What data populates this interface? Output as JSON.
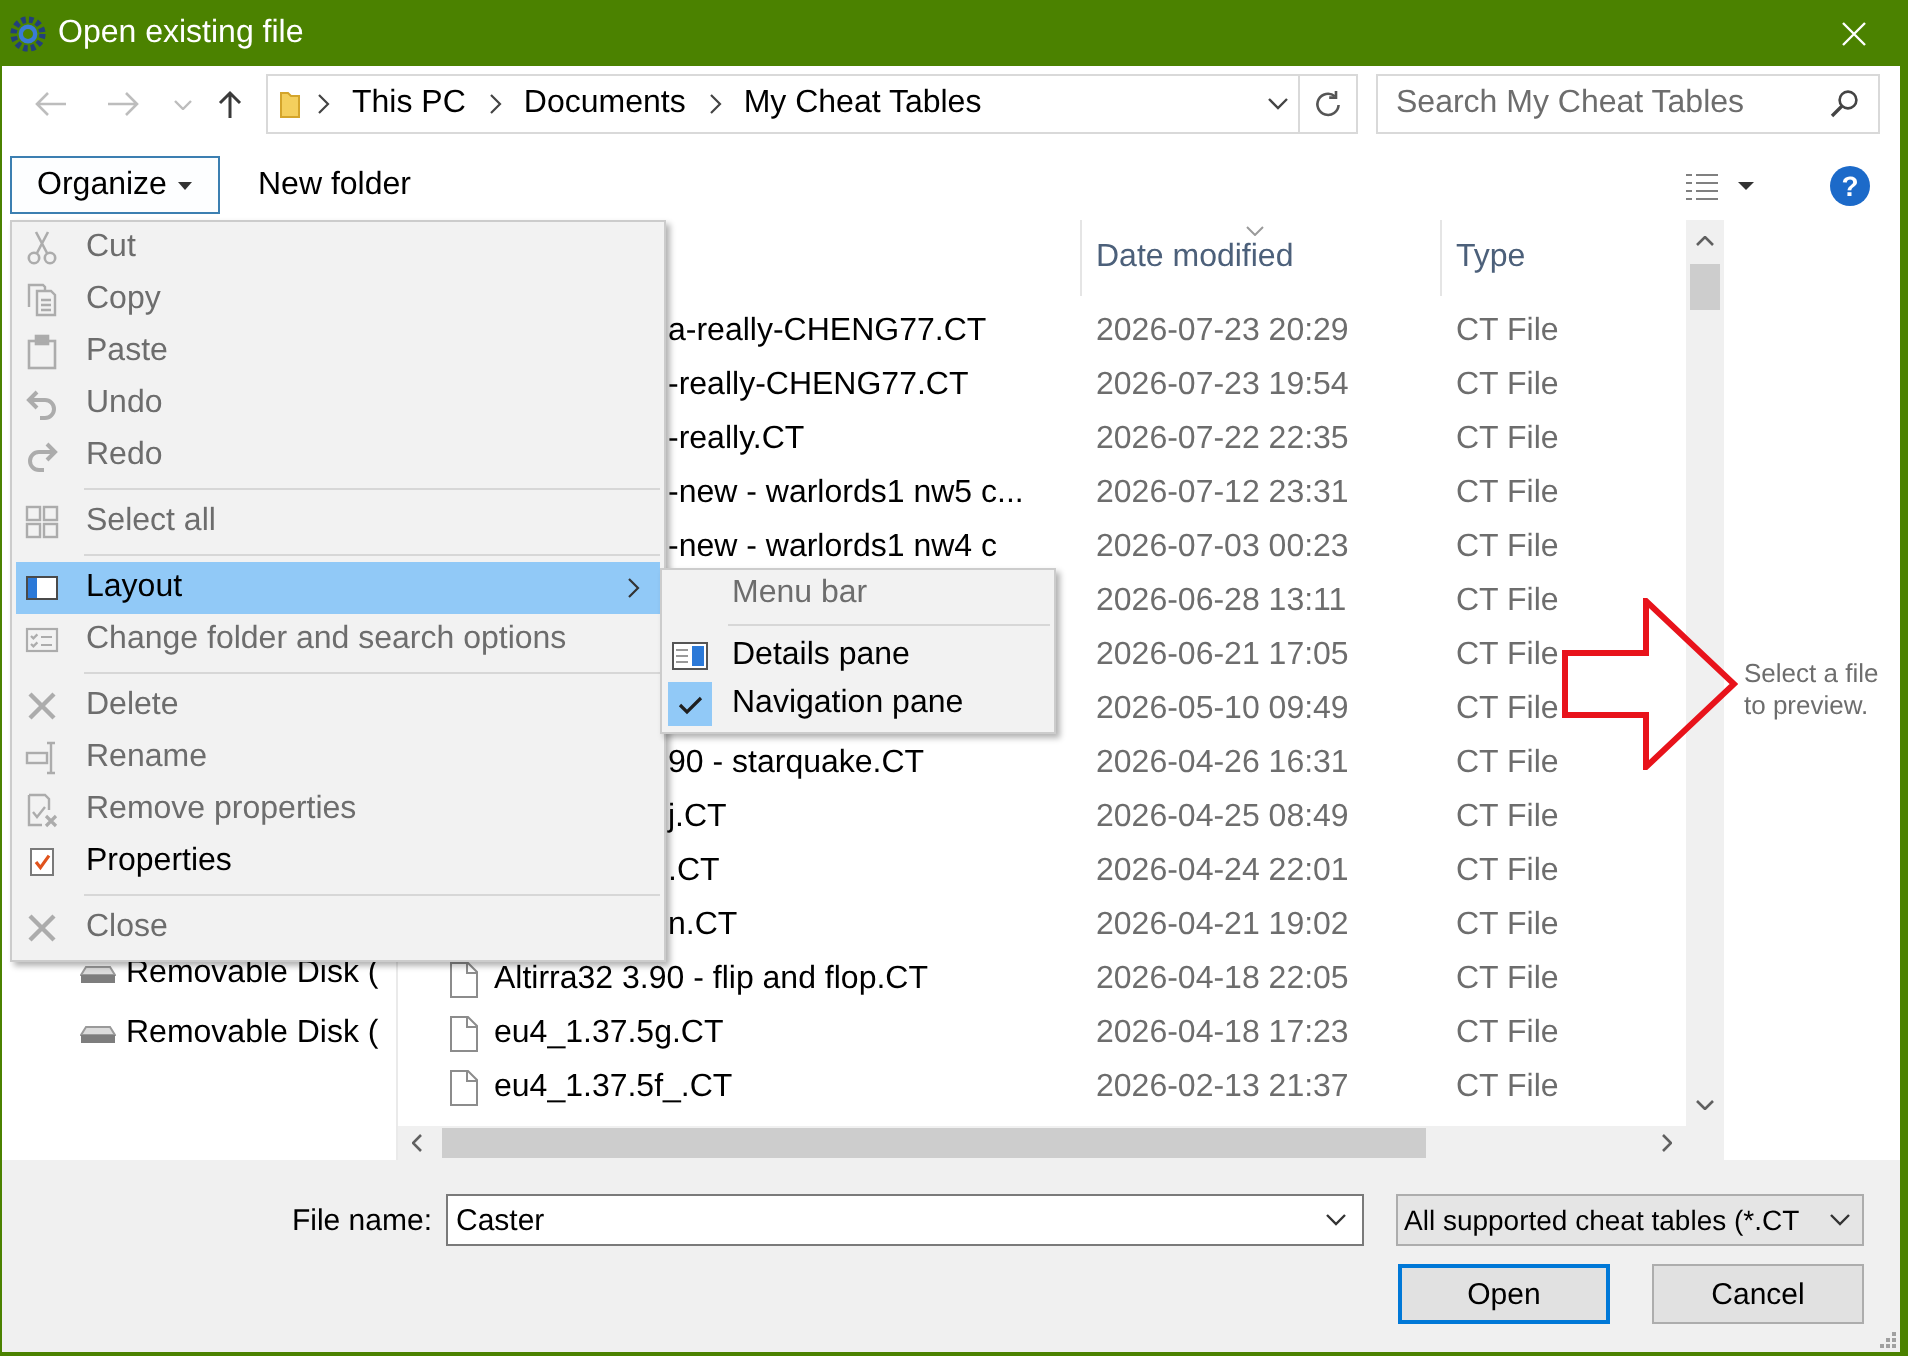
{
  "window": {
    "title": "Open existing file"
  },
  "history_buttons": [
    {
      "kind": "back",
      "disabled": true
    },
    {
      "kind": "forward",
      "disabled": true
    },
    {
      "kind": "recent",
      "disabled": true
    },
    {
      "kind": "up",
      "disabled": false
    }
  ],
  "address_bar": {
    "path": [
      "This PC",
      "Documents",
      "My Cheat Tables"
    ]
  },
  "search": {
    "placeholder": "Search My Cheat Tables"
  },
  "toolbar": {
    "organize": {
      "label": "Organize",
      "expanded": true
    },
    "new_folder": "New folder",
    "help": "?"
  },
  "organize_menu": {
    "groups": [
      [
        {
          "label": "Cut",
          "disabled": true,
          "highlighted": false,
          "submenu": false
        },
        {
          "label": "Copy",
          "disabled": true,
          "highlighted": false,
          "submenu": false
        },
        {
          "label": "Paste",
          "disabled": true,
          "highlighted": false,
          "submenu": false
        },
        {
          "label": "Undo",
          "disabled": true,
          "highlighted": false,
          "submenu": false
        },
        {
          "label": "Redo",
          "disabled": true,
          "highlighted": false,
          "submenu": false
        }
      ],
      [
        {
          "label": "Select all",
          "disabled": true,
          "highlighted": false,
          "submenu": false
        }
      ],
      [
        {
          "label": "Layout",
          "disabled": false,
          "highlighted": true,
          "submenu": true
        },
        {
          "label": "Change folder and search options",
          "disabled": true,
          "highlighted": false,
          "submenu": false
        }
      ],
      [
        {
          "label": "Delete",
          "disabled": true,
          "highlighted": false,
          "submenu": false
        },
        {
          "label": "Rename",
          "disabled": true,
          "highlighted": false,
          "submenu": false
        },
        {
          "label": "Remove properties",
          "disabled": true,
          "highlighted": false,
          "submenu": false
        },
        {
          "label": "Properties",
          "disabled": false,
          "highlighted": false,
          "submenu": false
        }
      ],
      [
        {
          "label": "Close",
          "disabled": true,
          "highlighted": false,
          "submenu": false
        }
      ]
    ]
  },
  "layout_submenu": {
    "groups": [
      [
        {
          "label": "Menu bar",
          "disabled": true,
          "checked": false
        }
      ],
      [
        {
          "label": "Details pane",
          "disabled": false,
          "checked": false
        },
        {
          "label": "Navigation pane",
          "disabled": false,
          "checked": true
        }
      ]
    ]
  },
  "navigation_pane": {
    "items": [
      {
        "label": "Removable Disk ("
      },
      {
        "label": "Removable Disk ("
      }
    ]
  },
  "file_list": {
    "columns": [
      {
        "label": "Date modified",
        "sorted": true
      },
      {
        "label": "Type",
        "sorted": false
      }
    ],
    "rows": [
      {
        "kind": "partial",
        "name": "a-really-CHENG77.CT",
        "date": "2026-07-23 20:29",
        "type": "CT File"
      },
      {
        "kind": "partial",
        "name": "-really-CHENG77.CT",
        "date": "2026-07-23 19:54",
        "type": "CT File"
      },
      {
        "kind": "partial",
        "name": "-really.CT",
        "date": "2026-07-22 22:35",
        "type": "CT File"
      },
      {
        "kind": "partial",
        "name": "-new - warlords1 nw5 c...",
        "date": "2026-07-12 23:31",
        "type": "CT File"
      },
      {
        "kind": "partial",
        "name": "-new - warlords1 nw4 c",
        "date": "2026-07-03 00:23",
        "type": "CT File"
      },
      {
        "kind": "covered",
        "date": "2026-06-28 13:11",
        "type": "CT File"
      },
      {
        "kind": "covered",
        "date": "2026-06-21 17:05",
        "type": "CT File"
      },
      {
        "kind": "covered",
        "date": "2026-05-10 09:49",
        "type": "CT File"
      },
      {
        "kind": "partial",
        "name": "90 - starquake.CT",
        "date": "2026-04-26 16:31",
        "type": "CT File"
      },
      {
        "kind": "partial",
        "name": "j.CT",
        "date": "2026-04-25 08:49",
        "type": "CT File"
      },
      {
        "kind": "partial",
        "name": ".CT",
        "date": "2026-04-24 22:01",
        "type": "CT File"
      },
      {
        "kind": "partial",
        "name": "n.CT",
        "date": "2026-04-21 19:02",
        "type": "CT File"
      },
      {
        "kind": "file",
        "name": "Altirra32 3.90 - flip and flop.CT",
        "date": "2026-04-18 22:05",
        "type": "CT File"
      },
      {
        "kind": "file",
        "name": "eu4_1.37.5g.CT",
        "date": "2026-04-18 17:23",
        "type": "CT File"
      },
      {
        "kind": "file",
        "name": "eu4_1.37.5f_.CT",
        "date": "2026-02-13 21:37",
        "type": "CT File"
      }
    ]
  },
  "preview": {
    "message": "Select a file to preview."
  },
  "file_name": {
    "label": "File name:",
    "value": "Caster"
  },
  "file_type": {
    "value": "All supported cheat tables (*.CT"
  },
  "buttons": [
    {
      "label": "Open",
      "default": true
    },
    {
      "label": "Cancel",
      "default": false
    }
  ]
}
